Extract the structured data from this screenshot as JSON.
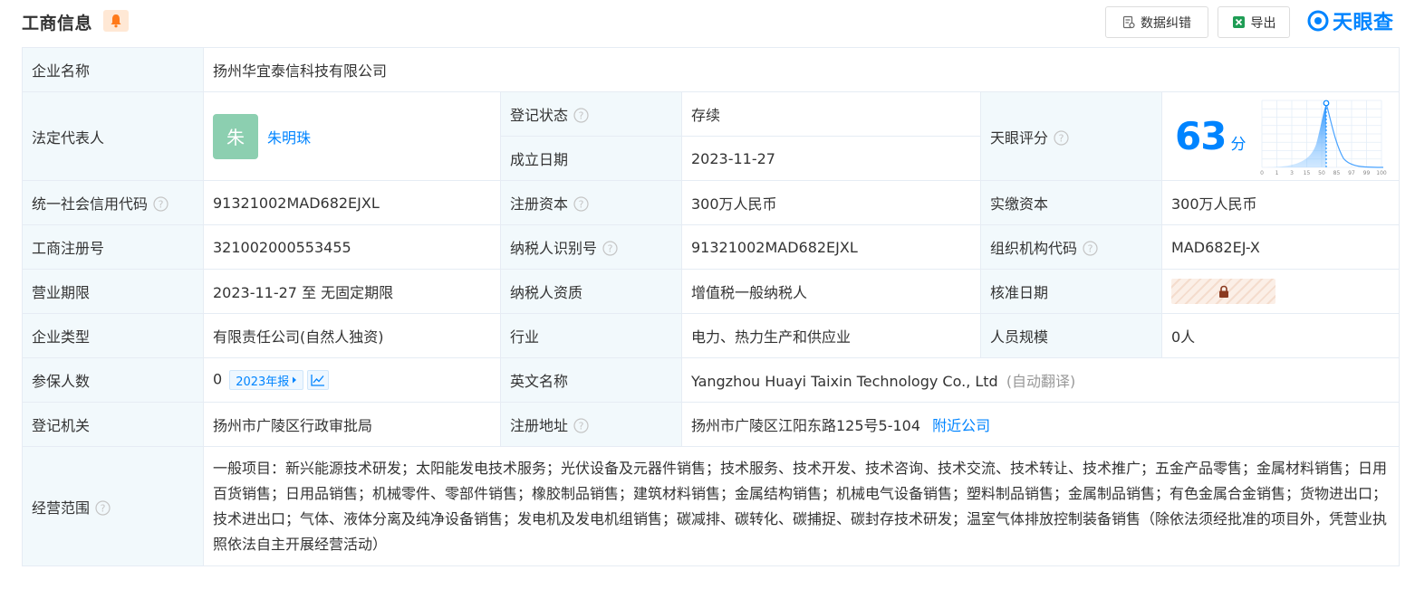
{
  "header": {
    "title": "工商信息",
    "correct_button": "数据纠错",
    "export_button": "导出",
    "brand": "天眼查"
  },
  "colors": {
    "accent": "#0084ff",
    "label_bg": "#f2f9fc",
    "status_green": "#52a04f",
    "avatar_bg": "#8ccfb0"
  },
  "company": {
    "name_label": "企业名称",
    "name_value": "扬州华宜泰信科技有限公司",
    "legal_rep_label": "法定代表人",
    "legal_rep_avatar": "朱",
    "legal_rep_name": "朱明珠",
    "status_label": "登记状态",
    "status_value": "存续",
    "founded_label": "成立日期",
    "founded_value": "2023-11-27",
    "score_label": "天眼评分",
    "score_value": "63",
    "score_unit": "分",
    "score_axis": [
      "0",
      "1",
      "3",
      "15",
      "50",
      "85",
      "97",
      "99",
      "100"
    ],
    "credit_code_label": "统一社会信用代码",
    "credit_code_value": "91321002MAD682EJXL",
    "reg_capital_label": "注册资本",
    "reg_capital_value": "300万人民币",
    "paid_capital_label": "实缴资本",
    "paid_capital_value": "300万人民币",
    "biz_reg_no_label": "工商注册号",
    "biz_reg_no_value": "321002000553455",
    "taxpayer_id_label": "纳税人识别号",
    "taxpayer_id_value": "91321002MAD682EJXL",
    "org_code_label": "组织机构代码",
    "org_code_value": "MAD682EJ-X",
    "term_label": "营业期限",
    "term_value": "2023-11-27 至 无固定期限",
    "tax_qual_label": "纳税人资质",
    "tax_qual_value": "增值税一般纳税人",
    "approval_date_label": "核准日期",
    "type_label": "企业类型",
    "type_value": "有限责任公司(自然人独资)",
    "industry_label": "行业",
    "industry_value": "电力、热力生产和供应业",
    "staff_label": "人员规模",
    "staff_value": "0人",
    "insured_label": "参保人数",
    "insured_value": "0",
    "insured_year_tag": "2023年报",
    "english_name_label": "英文名称",
    "english_name_value": "Yangzhou Huayi Taixin Technology Co., Ltd",
    "english_name_note": "(自动翻译)",
    "authority_label": "登记机关",
    "authority_value": "扬州市广陵区行政审批局",
    "address_label": "注册地址",
    "address_value": "扬州市广陵区江阳东路125号5-104",
    "nearby_link": "附近公司",
    "scope_label": "经营范围",
    "scope_value": "一般项目：新兴能源技术研发；太阳能发电技术服务；光伏设备及元器件销售；技术服务、技术开发、技术咨询、技术交流、技术转让、技术推广；五金产品零售；金属材料销售；日用百货销售；日用品销售；机械零件、零部件销售；橡胶制品销售；建筑材料销售；金属结构销售；机械电气设备销售；塑料制品销售；金属制品销售；有色金属合金销售；货物进出口；技术进出口；气体、液体分离及纯净设备销售；发电机及发电机组销售；碳减排、碳转化、碳捕捉、碳封存技术研发；温室气体排放控制装备销售（除依法须经批准的项目外，凭营业执照依法自主开展经营活动）"
  }
}
